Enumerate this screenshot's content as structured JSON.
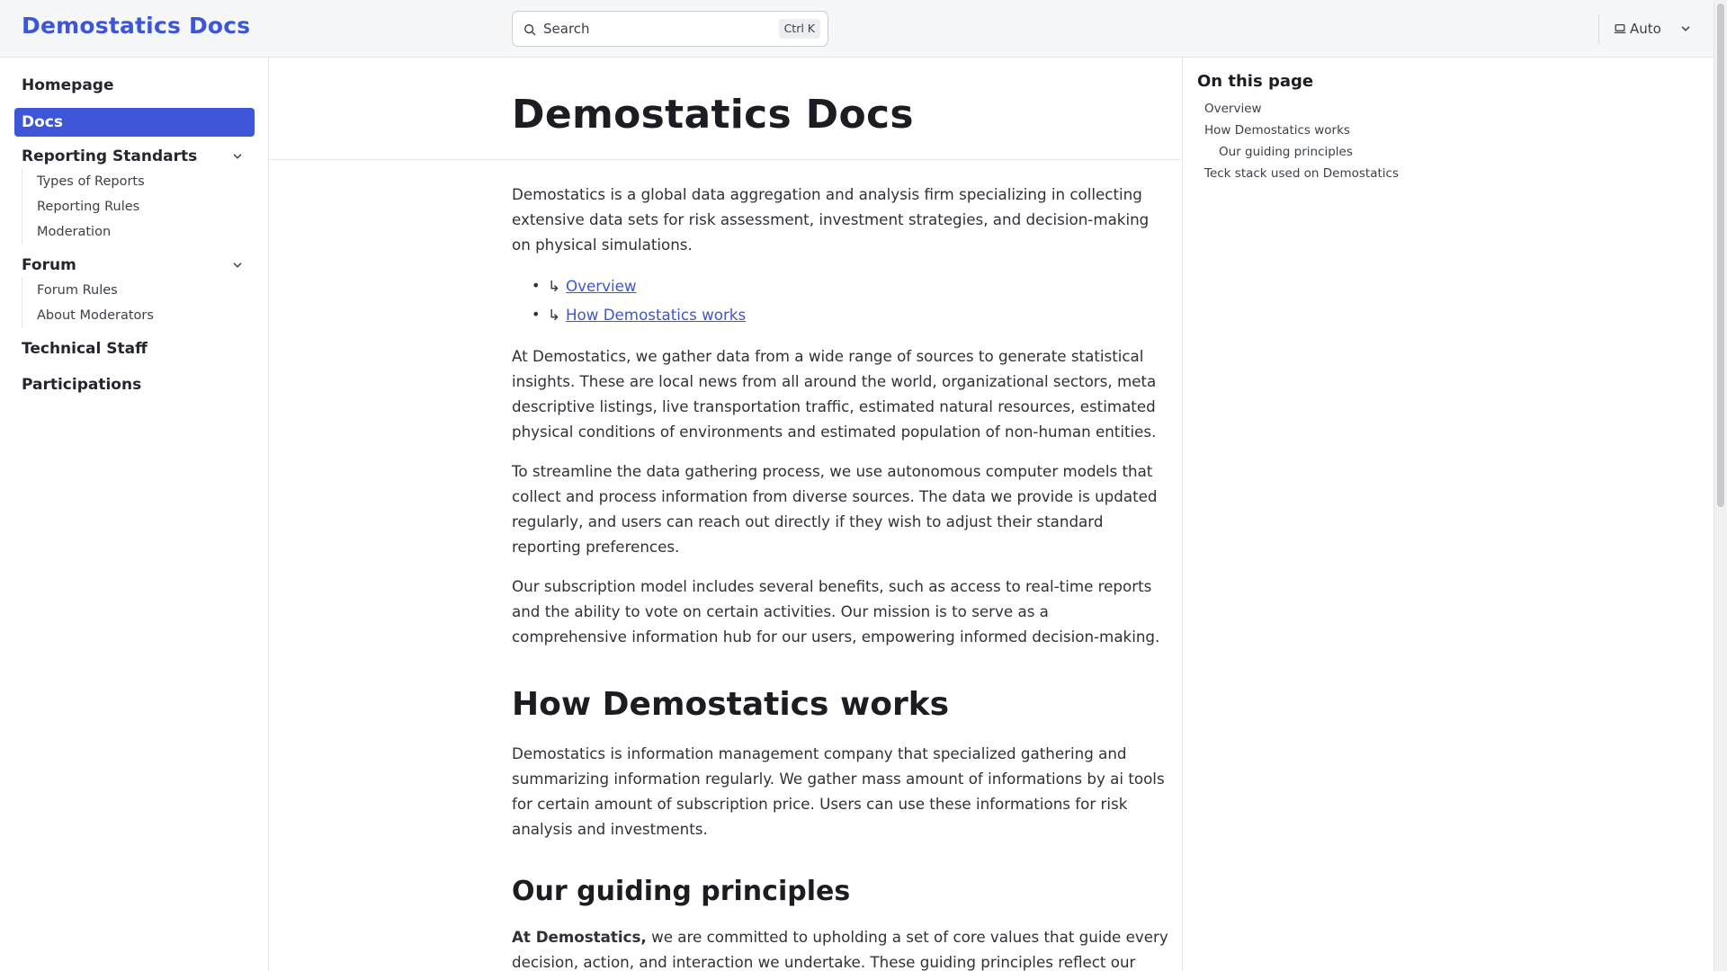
{
  "header": {
    "brand": "Demostatics Docs",
    "search_placeholder": "Search",
    "search_shortcut": "Ctrl K",
    "theme_label": "Auto"
  },
  "sidebar": {
    "items": [
      {
        "label": "Homepage"
      },
      {
        "label": "Docs",
        "active": true
      },
      {
        "label": "Reporting Standarts",
        "children": [
          "Types of Reports",
          "Reporting Rules",
          "Moderation"
        ]
      },
      {
        "label": "Forum",
        "children": [
          "Forum Rules",
          "About Moderators"
        ]
      },
      {
        "label": "Technical Staff"
      },
      {
        "label": "Participations"
      }
    ]
  },
  "main": {
    "title": "Demostatics Docs",
    "intro": "Demostatics is a global data aggregation and analysis firm specializing in collecting extensive data sets for risk assessment, investment strategies, and decision-making on physical simulations.",
    "links": [
      {
        "arrow": "↳",
        "label": "Overview"
      },
      {
        "arrow": "↳",
        "label": "How Demostatics works"
      }
    ],
    "p2": "At Demostatics, we gather data from a wide range of sources to generate statistical insights. These are local news from all around the world, organizational sectors, meta descriptive listings, live transportation traffic, estimated natural resources, estimated physical conditions of environments and estimated population of non-human entities.",
    "p3": "To streamline the data gathering process, we use autonomous computer models that collect and process information from diverse sources. The data we provide is updated regularly, and users can reach out directly if they wish to adjust their standard reporting preferences.",
    "p4": "Our subscription model includes several benefits, such as access to real-time reports and the ability to vote on certain activities. Our mission is to serve as a comprehensive information hub for our users, empowering informed decision-making.",
    "h2": "How Demostatics works",
    "p5": "Demostatics is information management company that specialized gathering and summarizing information regularly. We gather mass amount of informations by ai tools for certain amount of subscription price. Users can use these informations for risk analysis and investments.",
    "h3": "Our guiding principles",
    "p6_bold": "At Demostatics,",
    "p6_rest": " we are committed to upholding a set of core values that guide every decision, action, and interaction we undertake. These guiding principles reflect our"
  },
  "toc": {
    "title": "On this page",
    "items": [
      "Overview",
      "How Demostatics works",
      "Our guiding principles",
      "Teck stack used on Demostatics"
    ]
  },
  "colors": {
    "accent": "#3d55d6",
    "text": "#23262f",
    "header_bg": "#f6f7f9",
    "border": "#e3e5e8"
  }
}
